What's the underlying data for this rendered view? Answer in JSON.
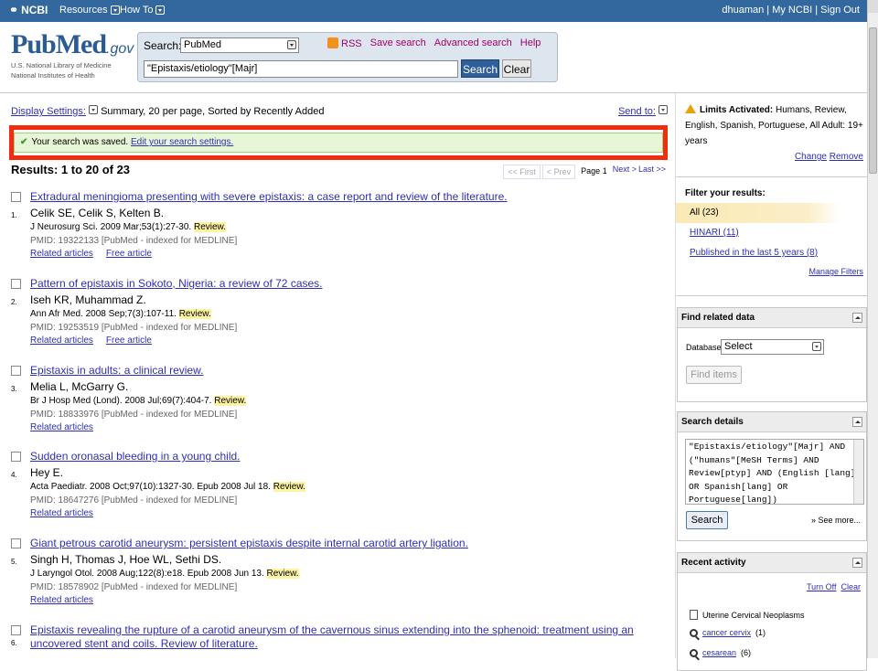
{
  "topbar": {
    "ncbi": "NCBI",
    "resources": "Resources",
    "howto": "How To",
    "user": "dhuaman | My NCBI | Sign Out"
  },
  "header": {
    "logo_pub": "PubMed",
    "logo_gov": ".gov",
    "logo_line1": "U.S. National Library of Medicine",
    "logo_line2": "National Institutes of Health",
    "search_label": "Search:",
    "db_value": "PubMed",
    "term_value": "\"Epistaxis/etiology\"[Majr]",
    "search_btn": "Search",
    "clear_btn": "Clear",
    "rss": "RSS",
    "save_search": "Save search",
    "advanced": "Advanced search",
    "help": "Help"
  },
  "display": {
    "settings_link": "Display Settings:",
    "settings_text": "Summary, 20 per page, Sorted by Recently Added",
    "send_to": "Send to:"
  },
  "saved": {
    "msg": "Your search was saved.",
    "link": "Edit your search settings."
  },
  "results": {
    "heading": "Results: 1 to 20 of 23",
    "pager": {
      "first": "<< First",
      "prev": "< Prev",
      "page": "Page 1",
      "next": "Next >",
      "last": "Last >>"
    },
    "items": [
      {
        "num": "1.",
        "title": "Extradural meningioma presenting with severe epistaxis: a case report and review of the literature.",
        "authors": "Celik SE, Celik S, Kelten B.",
        "journal": "J Neurosurg Sci. 2009 Mar;53(1):27-30.",
        "review": "Review.",
        "pmid": "PMID: 19322133 [PubMed - indexed for MEDLINE]",
        "related": "Related articles",
        "free": "Free article"
      },
      {
        "num": "2.",
        "title": "Pattern of epistaxis in Sokoto, Nigeria: a review of 72 cases.",
        "authors": "Iseh KR, Muhammad Z.",
        "journal": "Ann Afr Med. 2008 Sep;7(3):107-11.",
        "review": "Review.",
        "pmid": "PMID: 19253519 [PubMed - indexed for MEDLINE]",
        "related": "Related articles",
        "free": "Free article"
      },
      {
        "num": "3.",
        "title": "Epistaxis in adults: a clinical review.",
        "authors": "Melia L, McGarry G.",
        "journal": "Br J Hosp Med (Lond). 2008 Jul;69(7):404-7.",
        "review": "Review.",
        "pmid": "PMID: 18833976 [PubMed - indexed for MEDLINE]",
        "related": "Related articles",
        "free": ""
      },
      {
        "num": "4.",
        "title": "Sudden oronasal bleeding in a young child.",
        "authors": "Hey E.",
        "journal": "Acta Paediatr. 2008 Oct;97(10):1327-30. Epub 2008 Jul 18.",
        "review": "Review.",
        "pmid": "PMID: 18647276 [PubMed - indexed for MEDLINE]",
        "related": "Related articles",
        "free": ""
      },
      {
        "num": "5.",
        "title": "Giant petrous carotid aneurysm: persistent epistaxis despite internal carotid artery ligation.",
        "authors": "Singh H, Thomas J, Hoe WL, Sethi DS.",
        "journal": "J Laryngol Otol. 2008 Aug;122(8):e18. Epub 2008 Jun 13.",
        "review": "Review.",
        "pmid": "PMID: 18578902 [PubMed - indexed for MEDLINE]",
        "related": "Related articles",
        "free": ""
      },
      {
        "num": "6.",
        "title": "Epistaxis revealing the rupture of a carotid aneurysm of the cavernous sinus extending into the sphenoid: treatment using an uncovered stent and coils. Review of literature.",
        "authors": "",
        "journal": "",
        "review": "",
        "pmid": "",
        "related": "",
        "free": ""
      }
    ]
  },
  "sidebar": {
    "limits_bold": "Limits Activated:",
    "limits_text": "Humans, Review, English, Spanish, Portuguese, All Adult: 19+ years",
    "change": "Change",
    "remove": "Remove",
    "filter_head": "Filter your results:",
    "filters": [
      "All (23)",
      "HINARI (11)",
      "Published in the last 5 years (8)"
    ],
    "manage": "Manage Filters",
    "related_head": "Find related data",
    "db_label": "Database:",
    "db_select": "Select",
    "find_items": "Find items",
    "details_head": "Search details",
    "details_query": "\"Epistaxis/etiology\"[Majr] AND (\"humans\"[MeSH Terms] AND Review[ptyp] AND (English [lang] OR Spanish[lang] OR Portuguese[lang])",
    "details_search": "Search",
    "see_more": "» See more...",
    "recent_head": "Recent activity",
    "turn_off": "Turn Off",
    "clear": "Clear",
    "recent": [
      {
        "text": "Uterine Cervical Neoplasms",
        "count": ""
      },
      {
        "text": "cancer cervix",
        "count": "(1)"
      },
      {
        "text": "cesarean",
        "count": "(6)"
      }
    ]
  }
}
